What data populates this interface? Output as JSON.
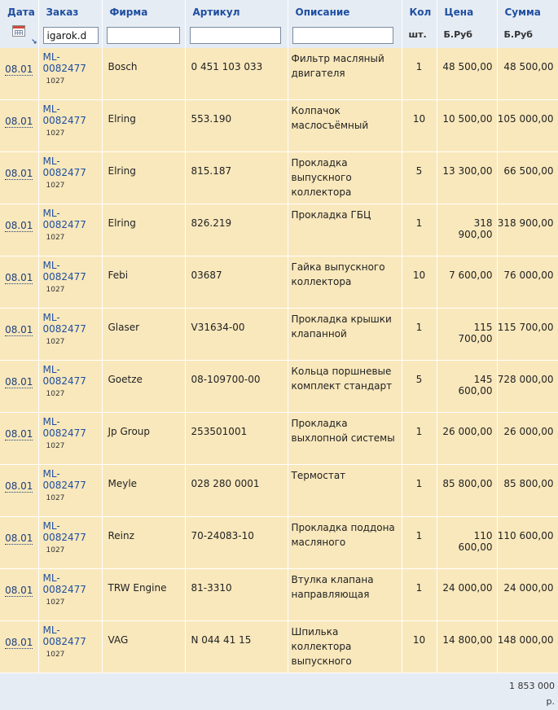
{
  "headers": {
    "date": "Дата",
    "order": "Заказ",
    "firm": "Фирма",
    "article": "Артикул",
    "description": "Описание",
    "qty": "Кол",
    "price": "Цена",
    "sum": "Сумма"
  },
  "units": {
    "qty": "шт.",
    "price": "Б.Руб",
    "sum": "Б.Руб"
  },
  "filters": {
    "order_value": "igarok.d",
    "firm_value": "",
    "article_value": "",
    "description_value": ""
  },
  "icons": {
    "calendar": "calendar-icon",
    "sort": "sort-arrow-icon"
  },
  "rows": [
    {
      "date": "08.01",
      "order": "ML-0082477",
      "order_sub": "1027",
      "firm": "Bosch",
      "article": "0 451 103 033",
      "description": "Фильтр масляный двигателя",
      "qty": "1",
      "price": "48 500,00",
      "sum": "48 500,00"
    },
    {
      "date": "08.01",
      "order": "ML-0082477",
      "order_sub": "1027",
      "firm": "Elring",
      "article": "553.190",
      "description": "Колпачок маслосъёмный",
      "qty": "10",
      "price": "10 500,00",
      "sum": "105 000,00"
    },
    {
      "date": "08.01",
      "order": "ML-0082477",
      "order_sub": "1027",
      "firm": "Elring",
      "article": "815.187",
      "description": "Прокладка выпускного коллектора",
      "qty": "5",
      "price": "13 300,00",
      "sum": "66 500,00"
    },
    {
      "date": "08.01",
      "order": "ML-0082477",
      "order_sub": "1027",
      "firm": "Elring",
      "article": "826.219",
      "description": "Прокладка ГБЦ",
      "qty": "1",
      "price": "318 900,00",
      "sum": "318 900,00"
    },
    {
      "date": "08.01",
      "order": "ML-0082477",
      "order_sub": "1027",
      "firm": "Febi",
      "article": "03687",
      "description": "Гайка выпускного коллектора",
      "qty": "10",
      "price": "7 600,00",
      "sum": "76 000,00"
    },
    {
      "date": "08.01",
      "order": "ML-0082477",
      "order_sub": "1027",
      "firm": "Glaser",
      "article": "V31634-00",
      "description": "Прокладка крышки клапанной",
      "qty": "1",
      "price": "115 700,00",
      "sum": "115 700,00"
    },
    {
      "date": "08.01",
      "order": "ML-0082477",
      "order_sub": "1027",
      "firm": "Goetze",
      "article": "08-109700-00",
      "description": "Кольца поршневые комплект стандарт",
      "qty": "5",
      "price": "145 600,00",
      "sum": "728 000,00"
    },
    {
      "date": "08.01",
      "order": "ML-0082477",
      "order_sub": "1027",
      "firm": "Jp Group",
      "article": "253501001",
      "description": "Прокладка выхлопной системы",
      "qty": "1",
      "price": "26 000,00",
      "sum": "26 000,00"
    },
    {
      "date": "08.01",
      "order": "ML-0082477",
      "order_sub": "1027",
      "firm": "Meyle",
      "article": "028 280 0001",
      "description": "Термостат",
      "qty": "1",
      "price": "85 800,00",
      "sum": "85 800,00"
    },
    {
      "date": "08.01",
      "order": "ML-0082477",
      "order_sub": "1027",
      "firm": "Reinz",
      "article": "70-24083-10",
      "description": "Прокладка поддона масляного",
      "qty": "1",
      "price": "110 600,00",
      "sum": "110 600,00"
    },
    {
      "date": "08.01",
      "order": "ML-0082477",
      "order_sub": "1027",
      "firm": "TRW Engine",
      "article": "81-3310",
      "description": "Втулка клапана направляющая",
      "qty": "1",
      "price": "24 000,00",
      "sum": "24 000,00"
    },
    {
      "date": "08.01",
      "order": "ML-0082477",
      "order_sub": "1027",
      "firm": "VAG",
      "article": "N 044 41 15",
      "description": "Шпилька коллектора выпускного",
      "qty": "10",
      "price": "14 800,00",
      "sum": "148 000,00"
    }
  ],
  "total": {
    "value": "1 853 000",
    "unit": "р."
  },
  "colors": {
    "row_bg": "#f9e8bc",
    "header_bg": "#e6ecf4",
    "link": "#1f4fa0"
  }
}
